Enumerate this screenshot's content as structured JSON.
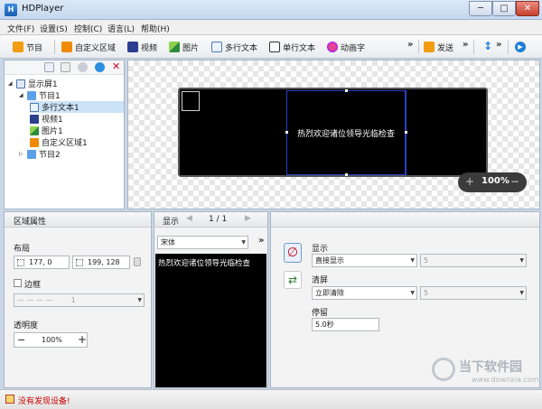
{
  "window": {
    "title": "HDPlayer",
    "min": "─",
    "max": "□",
    "close": "✕"
  },
  "menu": [
    "文件(F)",
    "设置(S)",
    "控制(C)",
    "语言(L)",
    "帮助(H)"
  ],
  "toolbar": {
    "program": "节目",
    "custom_area": "自定义区域",
    "video": "视频",
    "image": "图片",
    "multiline_text": "多行文本",
    "single_line_text": "单行文本",
    "animated_text": "动画字",
    "more": "»",
    "send": "发送"
  },
  "tree": {
    "screen": "显示屏1",
    "program1": "节目1",
    "multiline1": "多行文本1",
    "video1": "视频1",
    "image1": "图片1",
    "custom1": "自定义区域1",
    "program2": "节目2"
  },
  "canvas": {
    "screen_text": "热烈欢迎诸位领导光临检查",
    "zoom": "100%",
    "zoom_minus": "−",
    "zoom_plus": "+"
  },
  "props": {
    "title": "区域属性",
    "layout_label": "布局",
    "pos": "177, 0",
    "size": "199, 128",
    "border_label": "边框",
    "border_value": "1",
    "opacity_label": "透明度",
    "opacity_value": "100%",
    "minus": "−",
    "plus": "+"
  },
  "text_panel": {
    "title": "显示",
    "page": "1 / 1",
    "font": "宋体",
    "content": "热烈欢迎诸位领导光临检查",
    "more": "»"
  },
  "effects": {
    "display_label": "显示",
    "display_value": "直接显示",
    "display_speed": "5",
    "clear_label": "清屏",
    "clear_value": "立即清除",
    "clear_speed": "5",
    "stay_label": "停留",
    "stay_value": "5.0秒"
  },
  "status": {
    "message": "没有发现设备!"
  },
  "watermark": {
    "brand": "当下软件园",
    "url": "www.downxia.com"
  }
}
